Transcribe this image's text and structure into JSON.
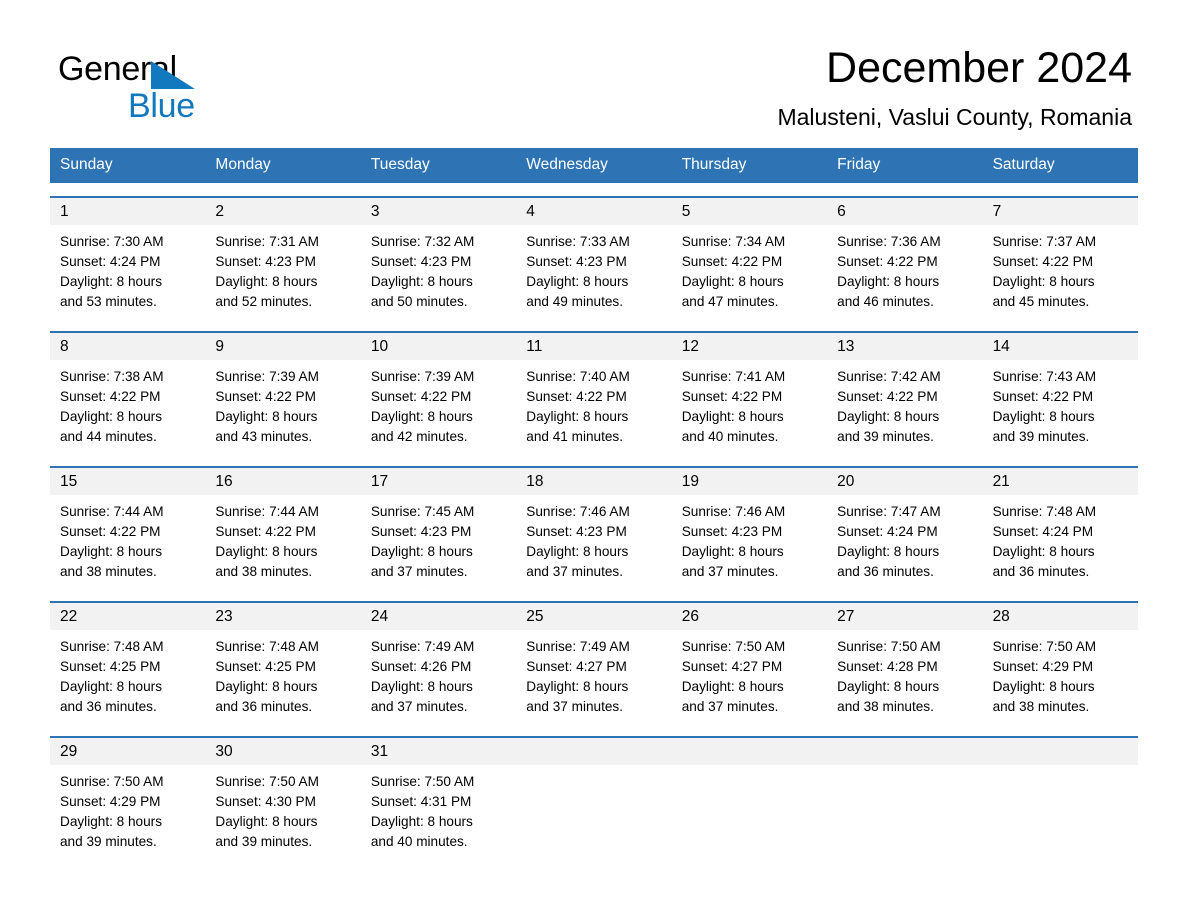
{
  "logo": {
    "word1": "General",
    "word2": "Blue",
    "triangle_color": "#1279be"
  },
  "header": {
    "title": "December 2024",
    "subtitle": "Malusteni, Vaslui County, Romania"
  },
  "theme": {
    "header_blue": "#2e74b5",
    "day_band_gray": "#f2f2f2",
    "text_black": "#000000",
    "logo_blue": "#1279be"
  },
  "weekdays": [
    "Sunday",
    "Monday",
    "Tuesday",
    "Wednesday",
    "Thursday",
    "Friday",
    "Saturday"
  ],
  "labels": {
    "sunrise_prefix": "Sunrise: ",
    "sunset_prefix": "Sunset: ",
    "daylight_prefix": "Daylight: "
  },
  "weeks": [
    [
      {
        "day": "1",
        "sunrise": "Sunrise: 7:30 AM",
        "sunset": "Sunset: 4:24 PM",
        "daylight_l1": "Daylight: 8 hours",
        "daylight_l2": "and 53 minutes."
      },
      {
        "day": "2",
        "sunrise": "Sunrise: 7:31 AM",
        "sunset": "Sunset: 4:23 PM",
        "daylight_l1": "Daylight: 8 hours",
        "daylight_l2": "and 52 minutes."
      },
      {
        "day": "3",
        "sunrise": "Sunrise: 7:32 AM",
        "sunset": "Sunset: 4:23 PM",
        "daylight_l1": "Daylight: 8 hours",
        "daylight_l2": "and 50 minutes."
      },
      {
        "day": "4",
        "sunrise": "Sunrise: 7:33 AM",
        "sunset": "Sunset: 4:23 PM",
        "daylight_l1": "Daylight: 8 hours",
        "daylight_l2": "and 49 minutes."
      },
      {
        "day": "5",
        "sunrise": "Sunrise: 7:34 AM",
        "sunset": "Sunset: 4:22 PM",
        "daylight_l1": "Daylight: 8 hours",
        "daylight_l2": "and 47 minutes."
      },
      {
        "day": "6",
        "sunrise": "Sunrise: 7:36 AM",
        "sunset": "Sunset: 4:22 PM",
        "daylight_l1": "Daylight: 8 hours",
        "daylight_l2": "and 46 minutes."
      },
      {
        "day": "7",
        "sunrise": "Sunrise: 7:37 AM",
        "sunset": "Sunset: 4:22 PM",
        "daylight_l1": "Daylight: 8 hours",
        "daylight_l2": "and 45 minutes."
      }
    ],
    [
      {
        "day": "8",
        "sunrise": "Sunrise: 7:38 AM",
        "sunset": "Sunset: 4:22 PM",
        "daylight_l1": "Daylight: 8 hours",
        "daylight_l2": "and 44 minutes."
      },
      {
        "day": "9",
        "sunrise": "Sunrise: 7:39 AM",
        "sunset": "Sunset: 4:22 PM",
        "daylight_l1": "Daylight: 8 hours",
        "daylight_l2": "and 43 minutes."
      },
      {
        "day": "10",
        "sunrise": "Sunrise: 7:39 AM",
        "sunset": "Sunset: 4:22 PM",
        "daylight_l1": "Daylight: 8 hours",
        "daylight_l2": "and 42 minutes."
      },
      {
        "day": "11",
        "sunrise": "Sunrise: 7:40 AM",
        "sunset": "Sunset: 4:22 PM",
        "daylight_l1": "Daylight: 8 hours",
        "daylight_l2": "and 41 minutes."
      },
      {
        "day": "12",
        "sunrise": "Sunrise: 7:41 AM",
        "sunset": "Sunset: 4:22 PM",
        "daylight_l1": "Daylight: 8 hours",
        "daylight_l2": "and 40 minutes."
      },
      {
        "day": "13",
        "sunrise": "Sunrise: 7:42 AM",
        "sunset": "Sunset: 4:22 PM",
        "daylight_l1": "Daylight: 8 hours",
        "daylight_l2": "and 39 minutes."
      },
      {
        "day": "14",
        "sunrise": "Sunrise: 7:43 AM",
        "sunset": "Sunset: 4:22 PM",
        "daylight_l1": "Daylight: 8 hours",
        "daylight_l2": "and 39 minutes."
      }
    ],
    [
      {
        "day": "15",
        "sunrise": "Sunrise: 7:44 AM",
        "sunset": "Sunset: 4:22 PM",
        "daylight_l1": "Daylight: 8 hours",
        "daylight_l2": "and 38 minutes."
      },
      {
        "day": "16",
        "sunrise": "Sunrise: 7:44 AM",
        "sunset": "Sunset: 4:22 PM",
        "daylight_l1": "Daylight: 8 hours",
        "daylight_l2": "and 38 minutes."
      },
      {
        "day": "17",
        "sunrise": "Sunrise: 7:45 AM",
        "sunset": "Sunset: 4:23 PM",
        "daylight_l1": "Daylight: 8 hours",
        "daylight_l2": "and 37 minutes."
      },
      {
        "day": "18",
        "sunrise": "Sunrise: 7:46 AM",
        "sunset": "Sunset: 4:23 PM",
        "daylight_l1": "Daylight: 8 hours",
        "daylight_l2": "and 37 minutes."
      },
      {
        "day": "19",
        "sunrise": "Sunrise: 7:46 AM",
        "sunset": "Sunset: 4:23 PM",
        "daylight_l1": "Daylight: 8 hours",
        "daylight_l2": "and 37 minutes."
      },
      {
        "day": "20",
        "sunrise": "Sunrise: 7:47 AM",
        "sunset": "Sunset: 4:24 PM",
        "daylight_l1": "Daylight: 8 hours",
        "daylight_l2": "and 36 minutes."
      },
      {
        "day": "21",
        "sunrise": "Sunrise: 7:48 AM",
        "sunset": "Sunset: 4:24 PM",
        "daylight_l1": "Daylight: 8 hours",
        "daylight_l2": "and 36 minutes."
      }
    ],
    [
      {
        "day": "22",
        "sunrise": "Sunrise: 7:48 AM",
        "sunset": "Sunset: 4:25 PM",
        "daylight_l1": "Daylight: 8 hours",
        "daylight_l2": "and 36 minutes."
      },
      {
        "day": "23",
        "sunrise": "Sunrise: 7:48 AM",
        "sunset": "Sunset: 4:25 PM",
        "daylight_l1": "Daylight: 8 hours",
        "daylight_l2": "and 36 minutes."
      },
      {
        "day": "24",
        "sunrise": "Sunrise: 7:49 AM",
        "sunset": "Sunset: 4:26 PM",
        "daylight_l1": "Daylight: 8 hours",
        "daylight_l2": "and 37 minutes."
      },
      {
        "day": "25",
        "sunrise": "Sunrise: 7:49 AM",
        "sunset": "Sunset: 4:27 PM",
        "daylight_l1": "Daylight: 8 hours",
        "daylight_l2": "and 37 minutes."
      },
      {
        "day": "26",
        "sunrise": "Sunrise: 7:50 AM",
        "sunset": "Sunset: 4:27 PM",
        "daylight_l1": "Daylight: 8 hours",
        "daylight_l2": "and 37 minutes."
      },
      {
        "day": "27",
        "sunrise": "Sunrise: 7:50 AM",
        "sunset": "Sunset: 4:28 PM",
        "daylight_l1": "Daylight: 8 hours",
        "daylight_l2": "and 38 minutes."
      },
      {
        "day": "28",
        "sunrise": "Sunrise: 7:50 AM",
        "sunset": "Sunset: 4:29 PM",
        "daylight_l1": "Daylight: 8 hours",
        "daylight_l2": "and 38 minutes."
      }
    ],
    [
      {
        "day": "29",
        "sunrise": "Sunrise: 7:50 AM",
        "sunset": "Sunset: 4:29 PM",
        "daylight_l1": "Daylight: 8 hours",
        "daylight_l2": "and 39 minutes."
      },
      {
        "day": "30",
        "sunrise": "Sunrise: 7:50 AM",
        "sunset": "Sunset: 4:30 PM",
        "daylight_l1": "Daylight: 8 hours",
        "daylight_l2": "and 39 minutes."
      },
      {
        "day": "31",
        "sunrise": "Sunrise: 7:50 AM",
        "sunset": "Sunset: 4:31 PM",
        "daylight_l1": "Daylight: 8 hours",
        "daylight_l2": "and 40 minutes."
      },
      {
        "day": "",
        "sunrise": "",
        "sunset": "",
        "daylight_l1": "",
        "daylight_l2": ""
      },
      {
        "day": "",
        "sunrise": "",
        "sunset": "",
        "daylight_l1": "",
        "daylight_l2": ""
      },
      {
        "day": "",
        "sunrise": "",
        "sunset": "",
        "daylight_l1": "",
        "daylight_l2": ""
      },
      {
        "day": "",
        "sunrise": "",
        "sunset": "",
        "daylight_l1": "",
        "daylight_l2": ""
      }
    ]
  ]
}
